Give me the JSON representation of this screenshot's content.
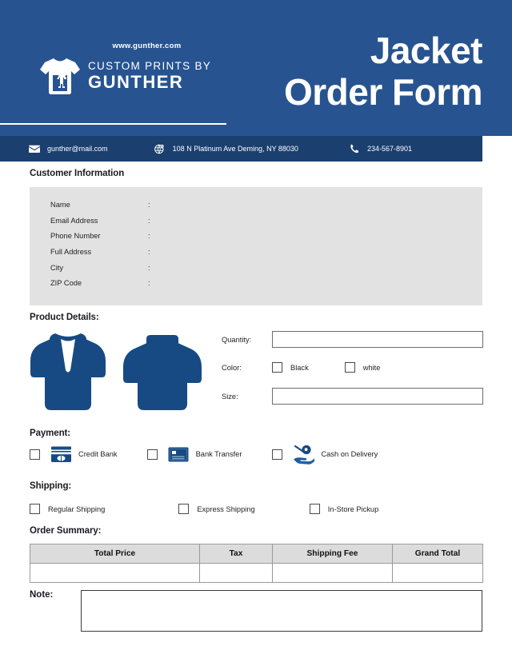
{
  "colors": {
    "brand_blue": "#275490",
    "contact_bar_blue": "#1b3f6e",
    "panel_gray": "#e2e2e2",
    "table_header_gray": "#dcdcdc",
    "text_dark": "#1b1b24"
  },
  "header": {
    "website": "www.gunther.com",
    "logo_line1": "CUSTOM PRINTS BY",
    "logo_line2": "GUNTHER",
    "title_line1": "Jacket",
    "title_line2": "Order Form"
  },
  "contact": {
    "email": "gunther@mail.com",
    "address": "108 N Platinum Ave Deming, NY 88030",
    "phone": "234-567-8901",
    "email_icon": "envelope-icon",
    "address_icon": "globe-pin-icon",
    "phone_icon": "phone-icon"
  },
  "customer_information": {
    "title": "Customer Information",
    "fields": [
      {
        "label": "Name",
        "separator": ":",
        "value": ""
      },
      {
        "label": "Email Address",
        "separator": ":",
        "value": ""
      },
      {
        "label": "Phone Number",
        "separator": ":",
        "value": ""
      },
      {
        "label": "Full Address",
        "separator": ":",
        "value": ""
      },
      {
        "label": "City",
        "separator": ":",
        "value": ""
      },
      {
        "label": "ZIP Code",
        "separator": ":",
        "value": ""
      }
    ]
  },
  "product_details": {
    "title": "Product Details:",
    "images": [
      {
        "name": "jacket-front-illustration"
      },
      {
        "name": "hoodie-illustration"
      }
    ],
    "quantity": {
      "label": "Quantity:",
      "value": "",
      "placeholder": ""
    },
    "color": {
      "label": "Color:",
      "options": [
        {
          "label": "Black",
          "checked": false
        },
        {
          "label": "white",
          "checked": false
        }
      ]
    },
    "size": {
      "label": "Size:",
      "value": "",
      "placeholder": ""
    }
  },
  "payment": {
    "title": "Payment:",
    "options": [
      {
        "label": "Credit Bank",
        "icon": "credit-card-icon",
        "checked": false
      },
      {
        "label": "Bank Transfer",
        "icon": "bank-card-icon",
        "checked": false
      },
      {
        "label": "Cash on Delivery",
        "icon": "hand-cash-icon",
        "checked": false
      }
    ]
  },
  "shipping": {
    "title": "Shipping:",
    "options": [
      {
        "label": "Regular Shipping",
        "checked": false
      },
      {
        "label": "Express Shipping",
        "checked": false
      },
      {
        "label": "In-Store Pickup",
        "checked": false
      }
    ]
  },
  "order_summary": {
    "title": "Order Summary:",
    "columns": [
      "Total Price",
      "Tax",
      "Shipping Fee",
      "Grand Total"
    ],
    "rows": [
      [
        "",
        "",
        "",
        ""
      ]
    ]
  },
  "note": {
    "label": "Note:",
    "value": "",
    "placeholder": ""
  }
}
